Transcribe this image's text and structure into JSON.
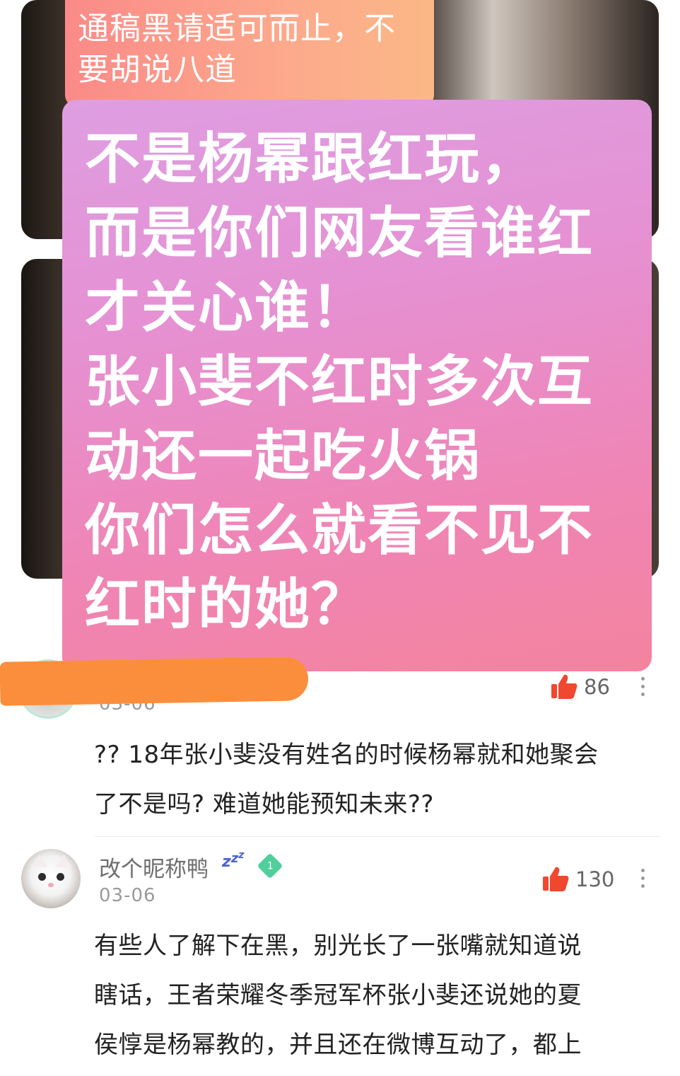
{
  "overlay": {
    "small_line1": "通稿黑请适可而止，不",
    "small_line2": "要胡说八道",
    "big_lines": [
      "不是杨幂跟红玩，",
      "而是你们网友看谁红",
      "才关心谁！",
      "张小斐不红时多次互",
      "动还一起吃火锅",
      "你们怎么就看不见不",
      "红时的她？"
    ]
  },
  "comments": [
    {
      "name": "",
      "date": "03-06",
      "likes": "86",
      "text_lines": [
        "?? 18年张小斐没有姓名的时候杨幂就和她聚会",
        "了不是吗? 难道她能预知未来??"
      ]
    },
    {
      "name": "改个昵称鸭",
      "badge_level": "1",
      "date": "03-06",
      "likes": "130",
      "text_lines": [
        "有些人了解下在黑，别光长了一张嘴就知道说",
        "瞎话，王者荣耀冬季冠军杯张小斐还说她的夏",
        "侯惇是杨幂教的，并且还在微博互动了，都上"
      ]
    }
  ],
  "colors": {
    "like_red": "#f0472f",
    "badge_green": "#4fcf9a",
    "scribble_orange": "#fb8e3c"
  }
}
